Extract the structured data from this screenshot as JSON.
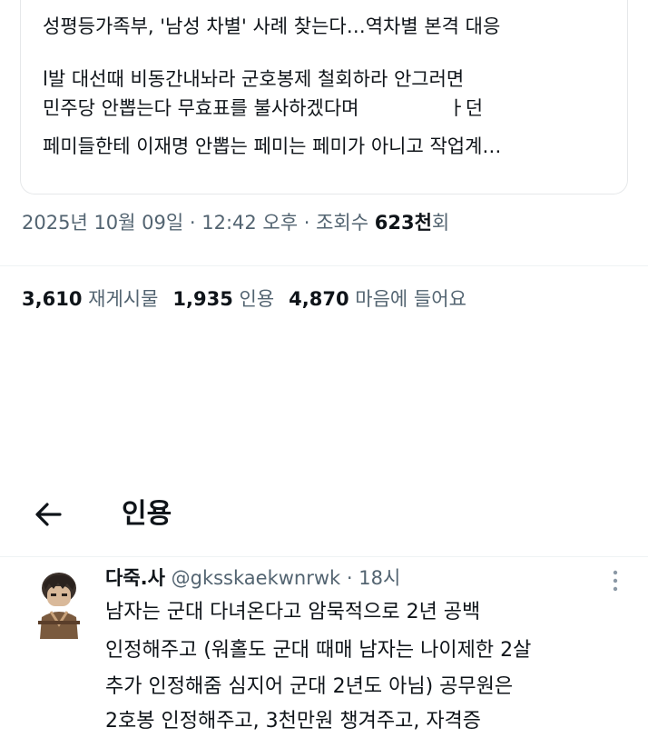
{
  "quoted_tweet": {
    "line1": "성평등가족부, '남성 차별' 사례 찾는다…역차별 본격 대응",
    "line2": "l발 대선때 비동간내놔라 군호봉제 철회하라 안그러면",
    "line3a": "민주당 안뽑는다 무효표를 불사하겠다며",
    "line3b": "ㅏ던",
    "line4": "페미들한테 이재명 안뽑는 페미는 페미가 아니고 작업계…"
  },
  "meta": {
    "date": "2025년 10월 09일",
    "sep1": " · ",
    "time": "12:42 오후",
    "sep2": " · ",
    "views_label": "조회수 ",
    "views_count": "623천",
    "views_suffix": "회"
  },
  "stats": {
    "retweets_count": "3,610",
    "retweets_label": "재게시물",
    "quotes_count": "1,935",
    "quotes_label": "인용",
    "likes_count": "4,870",
    "likes_label": "마음에 들어요"
  },
  "header": {
    "back_icon": "arrow-left-icon",
    "title": "인용"
  },
  "quote_tweet": {
    "display_name": "다죽.사",
    "handle": "@gksskaekwnrwk",
    "sep": " · ",
    "time": "18시",
    "more_icon": "more-vertical-icon",
    "lines": [
      "남자는 군대 다녀온다고 암묵적으로 2년 공백",
      "인정해주고 (워홀도 군대 때매 남자는 나이제한 2살",
      "추가 인정해줌 심지어 군대 2년도 아님) 공무원은",
      "2호봉 인정해주고, 3천만원 챙겨주고, 자격증"
    ]
  }
}
